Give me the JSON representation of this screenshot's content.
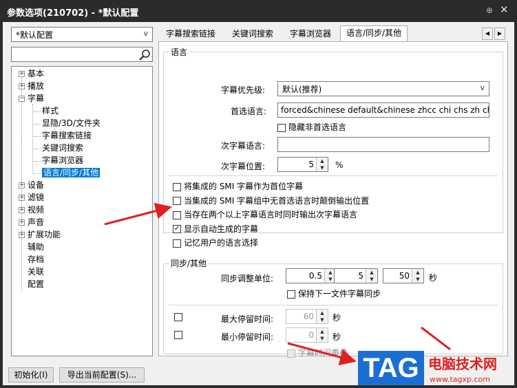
{
  "window": {
    "title": "参数选项(210702) - *默认配置",
    "pin_icon": "⊕",
    "close_icon": "✕"
  },
  "left": {
    "profile_value": "*默认配置",
    "tree": [
      {
        "label": "基本",
        "level": 0,
        "exp": "+"
      },
      {
        "label": "播放",
        "level": 0,
        "exp": "+"
      },
      {
        "label": "字幕",
        "level": 0,
        "exp": "−"
      },
      {
        "label": "样式",
        "level": 1
      },
      {
        "label": "显隐/3D/文件夹",
        "level": 1
      },
      {
        "label": "字幕搜索链接",
        "level": 1
      },
      {
        "label": "关键词搜索",
        "level": 1
      },
      {
        "label": "字幕浏览器",
        "level": 1
      },
      {
        "label": "语言/同步/其他",
        "level": 1,
        "selected": true
      },
      {
        "label": "设备",
        "level": 0,
        "exp": "+"
      },
      {
        "label": "滤镜",
        "level": 0,
        "exp": "+"
      },
      {
        "label": "视频",
        "level": 0,
        "exp": "+"
      },
      {
        "label": "声音",
        "level": 0,
        "exp": "+"
      },
      {
        "label": "扩展功能",
        "level": 0,
        "exp": "+"
      },
      {
        "label": "辅助",
        "level": 0
      },
      {
        "label": "存档",
        "level": 0
      },
      {
        "label": "关联",
        "level": 0
      },
      {
        "label": "配置",
        "level": 0
      }
    ]
  },
  "tabs": [
    "字幕搜索链接",
    "关键词搜索",
    "字幕浏览器",
    "语言/同步/其他"
  ],
  "language": {
    "group_label": "语言",
    "priority_label": "字幕优先级:",
    "priority_value": "默认(推荐)",
    "preferred_label": "首选语言:",
    "preferred_value": "forced&chinese default&chinese zhcc chi chs zh chinese",
    "hide_nonpreferred": "隐藏非首选语言",
    "secondary_label": "次字幕语言:",
    "secondary_value": "",
    "secondary_pos_label": "次字幕位置:",
    "secondary_pos_value": "5",
    "percent": "%",
    "options": [
      {
        "label": "将集成的 SMI 字幕作为首位字幕",
        "checked": false
      },
      {
        "label": "当集成的 SMI 字幕组中无首选语言时颠倒输出位置",
        "checked": false
      },
      {
        "label": "当存在两个以上字幕语言时同时输出次字幕语言",
        "checked": false
      },
      {
        "label": "显示自动生成的字幕",
        "checked": true
      },
      {
        "label": "记忆用户的语言选择",
        "checked": false
      }
    ]
  },
  "sync": {
    "group_label": "同步/其他",
    "unit_label": "同步调整单位:",
    "unit_values": [
      "0.5",
      "5",
      "50"
    ],
    "seconds": "秒",
    "keep_sync": "保持下一文件字幕同步",
    "max_label": "最大停留时间:",
    "max_value": "60",
    "min_label": "最小停留时间:",
    "min_value": "0",
    "overlap": "字幕时间重叠"
  },
  "buttons": {
    "init": "初始化(I)",
    "export": "导出当前配置(S)..."
  },
  "watermark": {
    "tag": "TAG",
    "site_name": "电脑技术网",
    "url": "www.tagxp.com"
  },
  "colors": {
    "selection": "#0078d7",
    "arrow": "#e02020",
    "tag_bg": "#1b6ed3"
  }
}
